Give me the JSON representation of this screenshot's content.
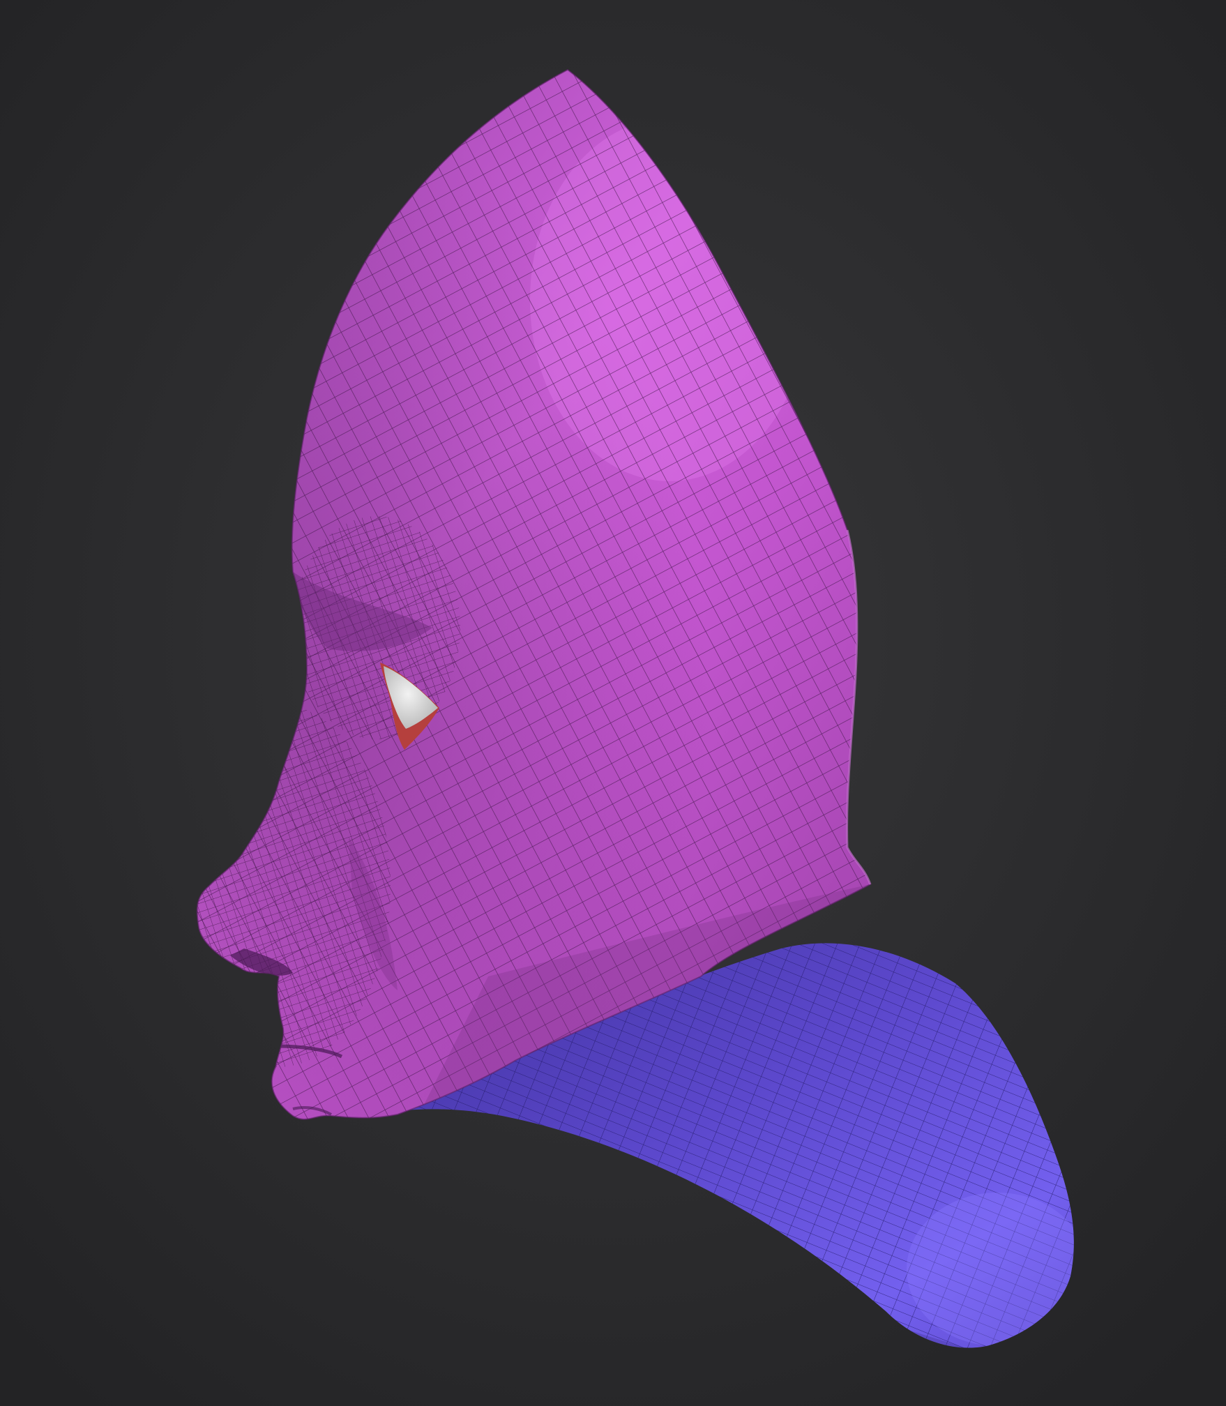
{
  "viewport": {
    "background": "#2a2a2c",
    "background_center": "#353537"
  },
  "model": {
    "face_color": "#c455d2",
    "face_highlight": "#dd6ee6",
    "face_shadow": "#8a3597",
    "neck_color": "#6a55e0",
    "neck_highlight": "#8570ff",
    "neck_shadow": "#3e2f9a",
    "eye_color": "#dcdcdc",
    "eyelid_color": "#b5403d",
    "wire_color": "#3a1442"
  }
}
